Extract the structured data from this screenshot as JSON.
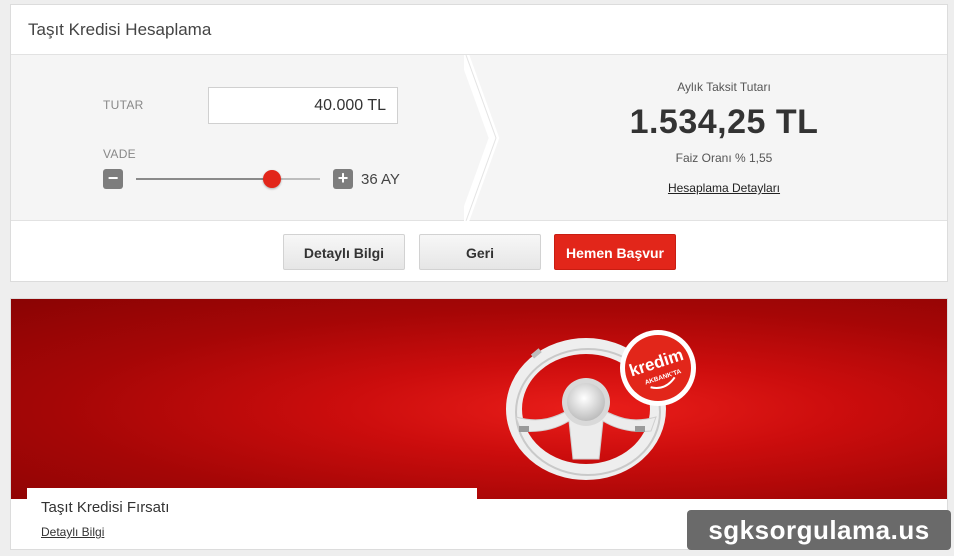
{
  "calculator": {
    "title": "Taşıt Kredisi Hesaplama",
    "amount_label": "TUTAR",
    "amount_value": "40.000 TL",
    "term_label": "VADE",
    "term_value": "36 AY",
    "term_slider_fraction": 0.74,
    "minus_symbol": "−",
    "plus_symbol": "+",
    "result_label": "Aylık Taksit Tutarı",
    "result_amount": "1.534,25 TL",
    "rate_text": "Faiz Oranı % 1,55",
    "details_link": "Hesaplama Detayları"
  },
  "actions": {
    "detail_label": "Detaylı Bilgi",
    "back_label": "Geri",
    "apply_label": "Hemen Başvur"
  },
  "promo": {
    "title": "Taşıt Kredisi Fırsatı",
    "link": "Detaylı Bilgi",
    "badge_text": "kredim",
    "badge_subtext": "AKBANK'TA"
  },
  "watermark": "sgksorgulama.us",
  "colors": {
    "accent_red": "#e2261a",
    "banner_dark": "#8a0404",
    "panel_bg": "#f5f5f5"
  }
}
